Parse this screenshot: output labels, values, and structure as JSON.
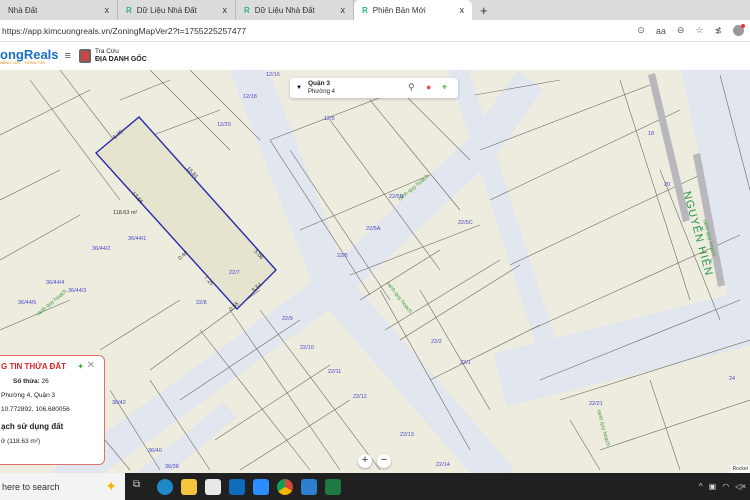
{
  "browser": {
    "tabs": [
      {
        "label": "Nhà Đất",
        "close": "x"
      },
      {
        "label": "Dữ Liệu Nhà Đất",
        "close": "x"
      },
      {
        "label": "Dữ Liệu Nhà Đất",
        "close": "x"
      },
      {
        "label": "Phiên Bản Mới",
        "close": "x",
        "active": true
      }
    ],
    "new_tab": "+",
    "url": "https://app.kimcuongreals.vn/ZoningMapVer2?t=1755225257477"
  },
  "app": {
    "logo": "ongReals",
    "logo_tagline": "NĂNG LỰC - HỒNG TÂY",
    "menu_icon": "≡",
    "tracuu_line1": "Tra Cứu",
    "tracuu_line2": "ĐỊA DANH GỐC"
  },
  "location": {
    "district": "Quận 3",
    "ward": "Phường 4"
  },
  "map": {
    "selected_area": "118.63 m²",
    "edges": [
      "5.79",
      "15.81",
      "13.66",
      "5.06",
      "0.40",
      "7.25",
      "5.54",
      "0.55"
    ],
    "parcels": [
      "12/16",
      "12/18",
      "12/20",
      "12/3",
      "12/5",
      "22/5B",
      "22/5A",
      "22/5",
      "22/5C",
      "22/7",
      "22/8",
      "22/9",
      "22/10",
      "22/11",
      "22/12",
      "22/13",
      "22/14",
      "22/2",
      "22/1",
      "22/21",
      "18",
      "20",
      "24",
      "36/44/2",
      "36/44/1",
      "36/44/3",
      "36/44/4",
      "36/44/5",
      "36/42",
      "36/40",
      "36/38"
    ],
    "zoning_label": "ranh quy hoạch",
    "street": "NGUYỄN HIỀN",
    "attribution": "Rocket"
  },
  "popup": {
    "title": "G TIN THỬA ĐẤT",
    "parcel_no_label": "Số thửa:",
    "parcel_no": "26",
    "address": "Phường 4, Quận 3",
    "coords": "10.772892, 106.680056",
    "section": "ạch sử dụng đất",
    "usage": "ở (118.63 m²)"
  },
  "zoom": {
    "in": "+",
    "out": "−"
  },
  "taskbar": {
    "search": "here to search"
  }
}
